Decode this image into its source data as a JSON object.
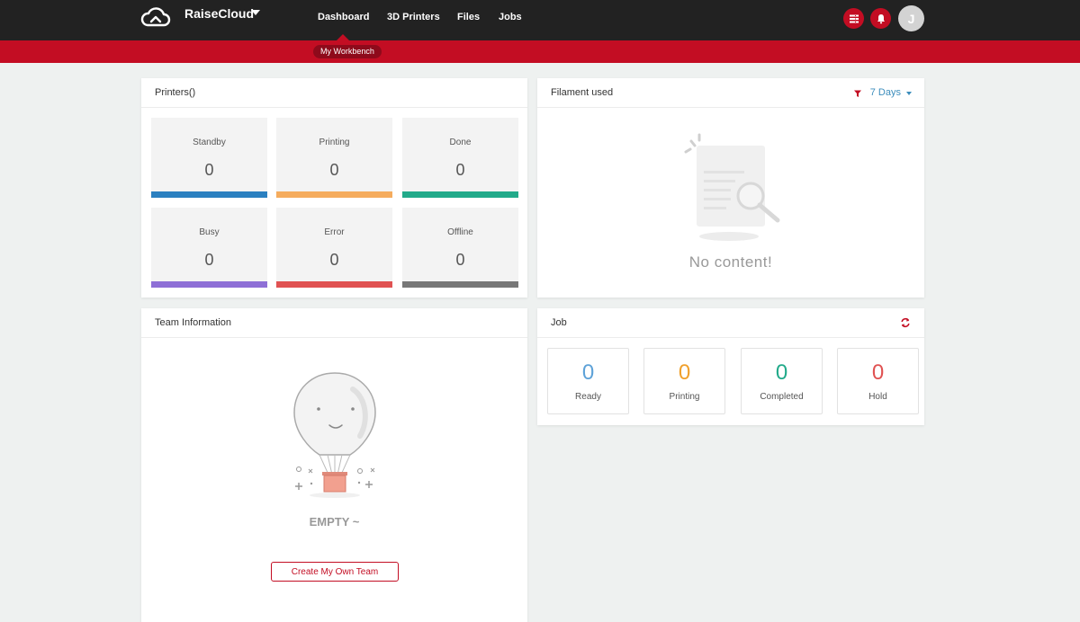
{
  "brand": {
    "name": "RaiseCloud"
  },
  "nav": {
    "items": [
      "Dashboard",
      "3D Printers",
      "Files",
      "Jobs"
    ],
    "active": "Dashboard",
    "sub": "My Workbench"
  },
  "user": {
    "initial": "J"
  },
  "icons": {
    "logo": "cloud-icon",
    "list": "list-icon",
    "bell": "bell-icon",
    "filter": "filter-icon",
    "refresh": "refresh-icon"
  },
  "colors": {
    "accent": "#c30d23",
    "topbar": "#222222",
    "standby": "#2b80c0",
    "printing": "#f5ac5e",
    "done": "#22aa8a",
    "busy": "#8e6fd6",
    "error": "#e05252",
    "offline": "#777777"
  },
  "printers": {
    "title": "Printers()",
    "stats": [
      {
        "label": "Standby",
        "value": "0",
        "color": "#2b80c0"
      },
      {
        "label": "Printing",
        "value": "0",
        "color": "#f5ac5e"
      },
      {
        "label": "Done",
        "value": "0",
        "color": "#22aa8a"
      },
      {
        "label": "Busy",
        "value": "0",
        "color": "#8e6fd6"
      },
      {
        "label": "Error",
        "value": "0",
        "color": "#e05252"
      },
      {
        "label": "Offline",
        "value": "0",
        "color": "#777777"
      }
    ]
  },
  "filament": {
    "title": "Filament used",
    "range": "7 Days",
    "empty": "No content!"
  },
  "team": {
    "title": "Team Information",
    "empty": "EMPTY ~",
    "create_label": "Create My Own Team"
  },
  "job": {
    "title": "Job",
    "stats": [
      {
        "label": "Ready",
        "value": "0",
        "color": "#5ea2d8"
      },
      {
        "label": "Printing",
        "value": "0",
        "color": "#f0a02c"
      },
      {
        "label": "Completed",
        "value": "0",
        "color": "#22aa8a"
      },
      {
        "label": "Hold",
        "value": "0",
        "color": "#e05252"
      }
    ]
  }
}
